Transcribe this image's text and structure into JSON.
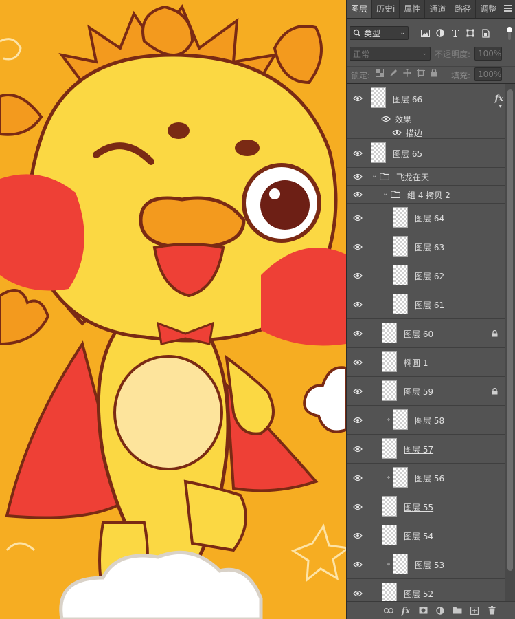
{
  "panel": {
    "tabs": [
      {
        "label": "图层",
        "active": true
      },
      {
        "label": "历史i",
        "active": false
      },
      {
        "label": "属性",
        "active": false
      },
      {
        "label": "通道",
        "active": false
      },
      {
        "label": "路径",
        "active": false
      },
      {
        "label": "调整",
        "active": false
      }
    ],
    "filter": {
      "selected": "类型",
      "icons": [
        "image-filter-icon",
        "adjustment-filter-icon",
        "text-filter-icon",
        "shape-filter-icon",
        "smart-object-filter-icon"
      ]
    },
    "blend_mode": "正常",
    "opacity_label": "不透明度:",
    "opacity_value": "100%",
    "lock_label": "锁定:",
    "fill_label": "填充:",
    "fill_value": "100%"
  },
  "layers": {
    "layer66": {
      "name": "图层 66",
      "effects_label": "效果",
      "stroke_label": "描边",
      "fx": "fx"
    },
    "layer65": {
      "name": "图层 65"
    },
    "group_flying": {
      "name": "飞龙在天"
    },
    "group4copy2": {
      "name": "组 4 拷贝 2"
    },
    "layer64": {
      "name": "图层 64"
    },
    "layer63": {
      "name": "图层 63"
    },
    "layer62": {
      "name": "图层 62"
    },
    "layer61": {
      "name": "图层 61"
    },
    "layer60": {
      "name": "图层 60"
    },
    "ellipse1": {
      "name": "椭圆 1"
    },
    "layer59": {
      "name": "图层 59"
    },
    "layer58": {
      "name": "图层 58"
    },
    "layer57": {
      "name": "图层 57"
    },
    "layer56": {
      "name": "图层 56"
    },
    "layer55": {
      "name": "图层 55"
    },
    "layer54": {
      "name": "图层 54"
    },
    "layer53": {
      "name": "图层 53"
    },
    "layer52": {
      "name": "图层 52"
    }
  },
  "bottom_bar": {
    "fx": "fx"
  },
  "colors": {
    "panel_bg": "#535353",
    "tab_bar_bg": "#3e3e3e",
    "canvas_orange": "#f6ad22",
    "dragon_yellow": "#fbd843",
    "dragon_outline": "#7a2a14",
    "cape_red": "#ee4036",
    "crest_orange": "#f39a1e"
  }
}
